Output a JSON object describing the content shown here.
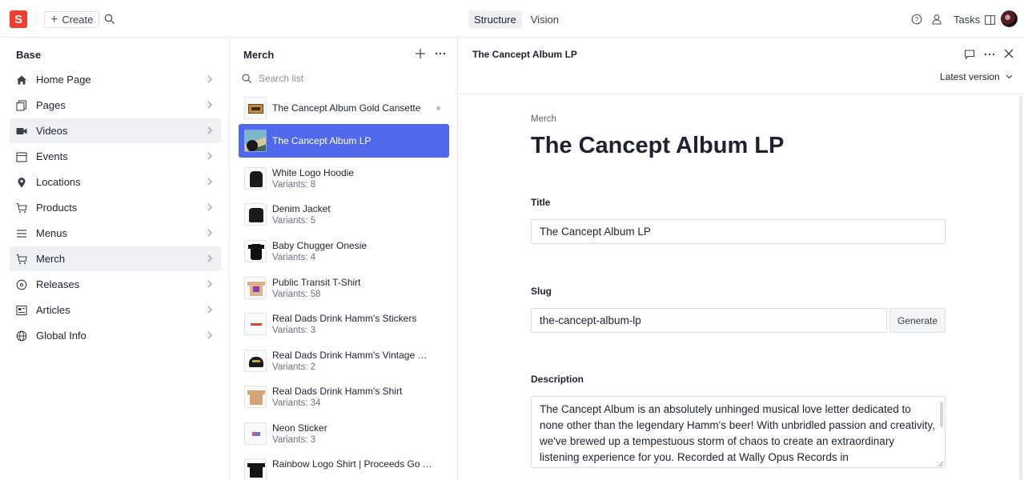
{
  "topbar": {
    "logo_letter": "S",
    "create_label": "Create",
    "modes": [
      "Structure",
      "Vision"
    ],
    "active_mode": "Structure",
    "tasks_label": "Tasks"
  },
  "sidebar": {
    "title": "Base",
    "items": [
      {
        "label": "Home Page",
        "icon": "home-icon"
      },
      {
        "label": "Pages",
        "icon": "pages-icon"
      },
      {
        "label": "Videos",
        "icon": "video-icon"
      },
      {
        "label": "Events",
        "icon": "calendar-icon"
      },
      {
        "label": "Locations",
        "icon": "location-pin-icon"
      },
      {
        "label": "Products",
        "icon": "cart-icon"
      },
      {
        "label": "Menus",
        "icon": "menu-icon"
      },
      {
        "label": "Merch",
        "icon": "cart-icon"
      },
      {
        "label": "Releases",
        "icon": "disc-icon"
      },
      {
        "label": "Articles",
        "icon": "articles-icon"
      },
      {
        "label": "Global Info",
        "icon": "globe-icon"
      }
    ]
  },
  "list": {
    "title": "Merch",
    "search_placeholder": "Search list",
    "items": [
      {
        "title": "The Cancept Album Gold Cansette",
        "subtitle": ""
      },
      {
        "title": "The Cancept Album LP",
        "subtitle": ""
      },
      {
        "title": "White Logo Hoodie",
        "subtitle": "Variants: 8"
      },
      {
        "title": "Denim Jacket",
        "subtitle": "Variants: 5"
      },
      {
        "title": "Baby Chugger Onesie",
        "subtitle": "Variants: 4"
      },
      {
        "title": "Public Transit T-Shirt",
        "subtitle": "Variants: 58"
      },
      {
        "title": "Real Dads Drink Hamm's Stickers",
        "subtitle": "Variants: 3"
      },
      {
        "title": "Real Dads Drink Hamm's Vintage C...",
        "subtitle": "Variants: 2"
      },
      {
        "title": "Real Dads Drink Hamm's Shirt",
        "subtitle": "Variants: 34"
      },
      {
        "title": "Neon Sticker",
        "subtitle": "Variants: 3"
      },
      {
        "title": "Rainbow Logo Shirt | Proceeds Go T...",
        "subtitle": ""
      }
    ]
  },
  "editor": {
    "header_title": "The Cancept Album LP",
    "version_label": "Latest version",
    "breadcrumb": "Merch",
    "heading": "The Cancept Album LP",
    "title_label": "Title",
    "title_value": "The Cancept Album LP",
    "slug_label": "Slug",
    "slug_value": "the-cancept-album-lp",
    "generate_label": "Generate",
    "description_label": "Description",
    "description_value": "The Cancept Album is an absolutely unhinged musical love letter dedicated to none other than the legendary Hamm's beer! With unbridled passion and creativity, we've brewed up a tempestuous storm of chaos to create an extraordinary listening experience for you. Recorded at Wally Opus Records in"
  },
  "colors": {
    "brand": "#f03e2f",
    "selected": "#5069ec"
  }
}
